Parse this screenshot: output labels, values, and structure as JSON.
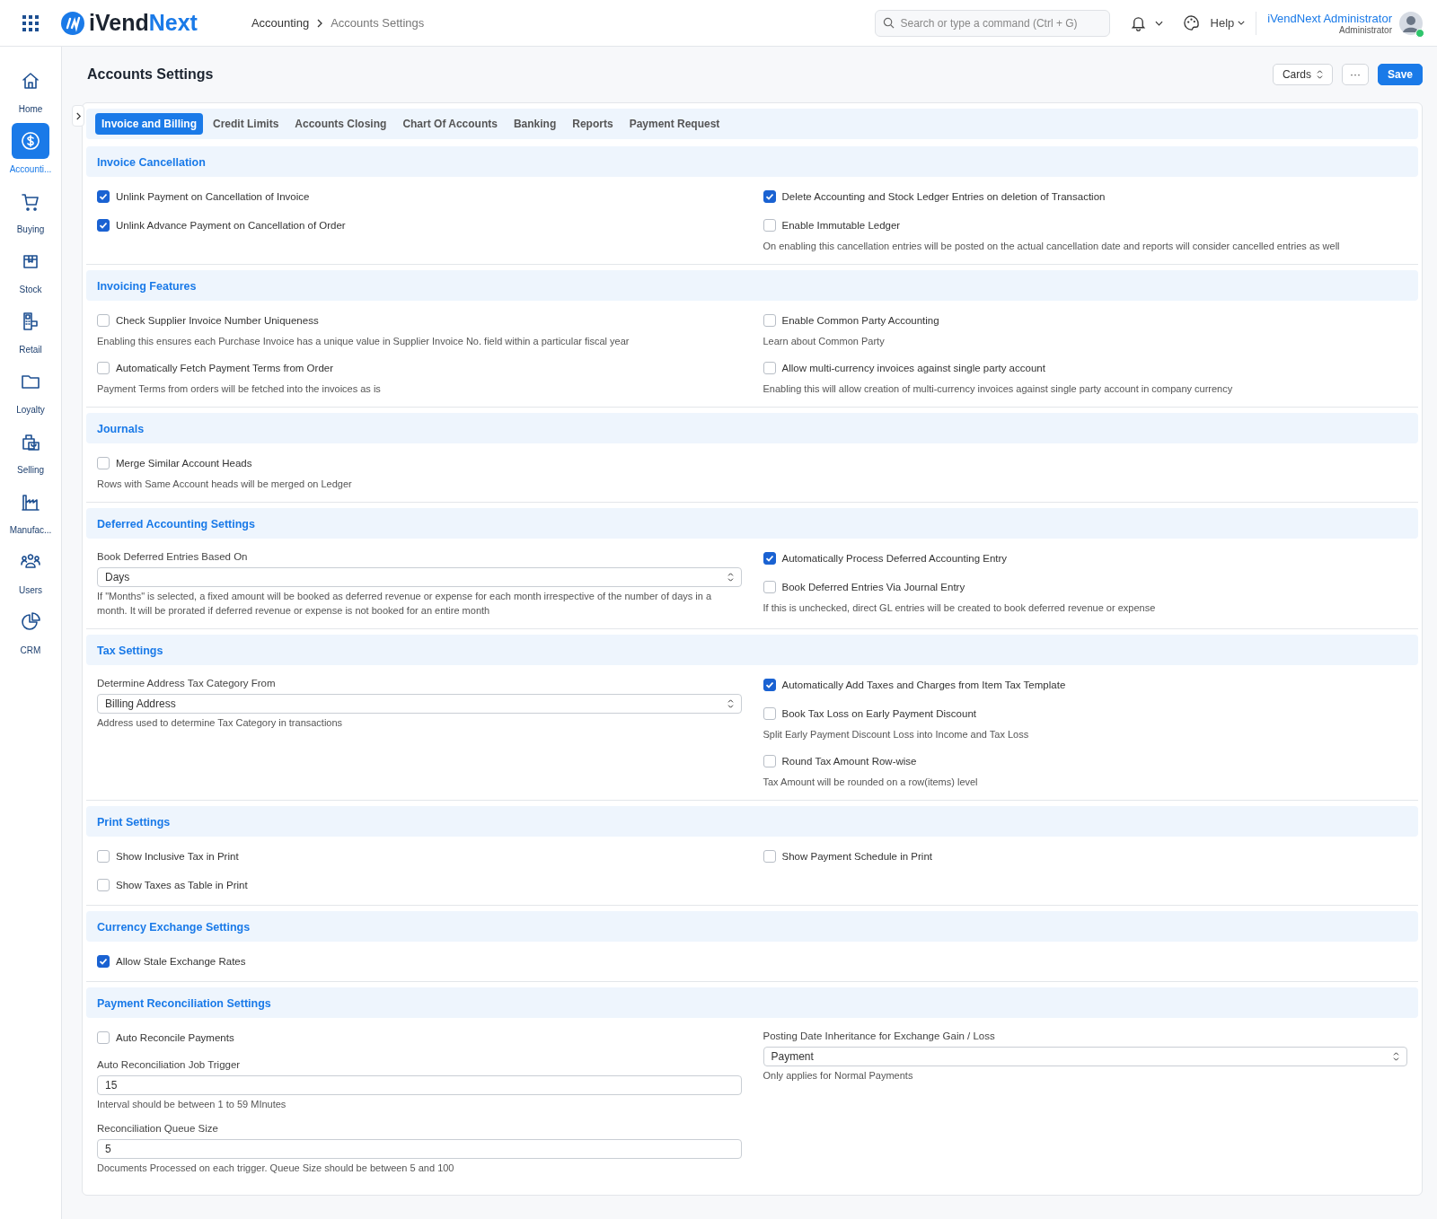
{
  "topbar": {
    "logo_prefix": "iVend",
    "logo_suffix": "Next",
    "breadcrumb": [
      "Accounting",
      "Accounts Settings"
    ],
    "search": {
      "placeholder": "Search or type a command (Ctrl + G)"
    },
    "help": "Help",
    "user": {
      "name": "iVendNext Administrator",
      "role": "Administrator"
    }
  },
  "sidebar": {
    "items": [
      {
        "label": "Home",
        "selected": false
      },
      {
        "label": "Accounti...",
        "selected": true
      },
      {
        "label": "Buying",
        "selected": false
      },
      {
        "label": "Stock",
        "selected": false
      },
      {
        "label": "Retail",
        "selected": false
      },
      {
        "label": "Loyalty",
        "selected": false
      },
      {
        "label": "Selling",
        "selected": false
      },
      {
        "label": "Manufac...",
        "selected": false
      },
      {
        "label": "Users",
        "selected": false
      },
      {
        "label": "CRM",
        "selected": false
      }
    ]
  },
  "page": {
    "title": "Accounts Settings",
    "view_button": "Cards",
    "more_button": "···",
    "save_button": "Save"
  },
  "tabs": [
    {
      "label": "Invoice and Billing",
      "selected": true
    },
    {
      "label": "Credit Limits",
      "selected": false
    },
    {
      "label": "Accounts Closing",
      "selected": false
    },
    {
      "label": "Chart Of Accounts",
      "selected": false
    },
    {
      "label": "Banking",
      "selected": false
    },
    {
      "label": "Reports",
      "selected": false
    },
    {
      "label": "Payment Request",
      "selected": false
    }
  ],
  "sections": [
    {
      "title": "Invoice Cancellation",
      "left": [
        {
          "kind": "check",
          "label": "Unlink Payment on Cancellation of Invoice",
          "checked": true
        },
        {
          "kind": "check",
          "label": "Unlink Advance Payment on Cancellation of Order",
          "checked": true
        }
      ],
      "right": [
        {
          "kind": "check",
          "label": "Delete Accounting and Stock Ledger Entries on deletion of Transaction",
          "checked": true
        },
        {
          "kind": "check",
          "label": "Enable Immutable Ledger",
          "checked": false,
          "help": "On enabling this cancellation entries will be posted on the actual cancellation date and reports will consider cancelled entries as well"
        }
      ]
    },
    {
      "title": "Invoicing Features",
      "left": [
        {
          "kind": "check",
          "label": "Check Supplier Invoice Number Uniqueness",
          "checked": false,
          "help": "Enabling this ensures each Purchase Invoice has a unique value in Supplier Invoice No. field within a particular fiscal year"
        },
        {
          "kind": "check",
          "label": "Automatically Fetch Payment Terms from Order",
          "checked": false,
          "help": "Payment Terms from orders will be fetched into the invoices as is"
        }
      ],
      "right": [
        {
          "kind": "check",
          "label": "Enable Common Party Accounting",
          "checked": false,
          "help": "Learn about Common Party"
        },
        {
          "kind": "check",
          "label": "Allow multi-currency invoices against single party account",
          "checked": false,
          "help": "Enabling this will allow creation of multi-currency invoices against single party account in company currency"
        }
      ]
    },
    {
      "title": "Journals",
      "left": [
        {
          "kind": "check",
          "label": "Merge Similar Account Heads",
          "checked": false,
          "help": "Rows with Same Account heads will be merged on Ledger"
        }
      ]
    },
    {
      "title": "Deferred Accounting Settings",
      "left": [
        {
          "kind": "select",
          "label": "Book Deferred Entries Based On",
          "value": "Days",
          "help": "If \"Months\" is selected, a fixed amount will be booked as deferred revenue or expense for each month irrespective of the number of days in a month. It will be prorated if deferred revenue or expense is not booked for an entire month"
        }
      ],
      "right": [
        {
          "kind": "check",
          "label": "Automatically Process Deferred Accounting Entry",
          "checked": true
        },
        {
          "kind": "check",
          "label": "Book Deferred Entries Via Journal Entry",
          "checked": false,
          "help": "If this is unchecked, direct GL entries will be created to book deferred revenue or expense"
        }
      ]
    },
    {
      "title": "Tax Settings",
      "left": [
        {
          "kind": "select",
          "label": "Determine Address Tax Category From",
          "value": "Billing Address",
          "help": "Address used to determine Tax Category in transactions"
        }
      ],
      "right": [
        {
          "kind": "check",
          "label": "Automatically Add Taxes and Charges from Item Tax Template",
          "checked": true
        },
        {
          "kind": "check",
          "label": "Book Tax Loss on Early Payment Discount",
          "checked": false,
          "help": "Split Early Payment Discount Loss into Income and Tax Loss"
        },
        {
          "kind": "check",
          "label": "Round Tax Amount Row-wise",
          "checked": false,
          "help": "Tax Amount will be rounded on a row(items) level"
        }
      ]
    },
    {
      "title": "Print Settings",
      "left": [
        {
          "kind": "check",
          "label": "Show Inclusive Tax in Print",
          "checked": false
        },
        {
          "kind": "check",
          "label": "Show Taxes as Table in Print",
          "checked": false
        }
      ],
      "right": [
        {
          "kind": "check",
          "label": "Show Payment Schedule in Print",
          "checked": false
        }
      ]
    },
    {
      "title": "Currency Exchange Settings",
      "left": [
        {
          "kind": "check",
          "label": "Allow Stale Exchange Rates",
          "checked": true
        }
      ]
    },
    {
      "title": "Payment Reconciliation Settings",
      "left": [
        {
          "kind": "check",
          "label": "Auto Reconcile Payments",
          "checked": false
        },
        {
          "kind": "input",
          "label": "Auto Reconciliation Job Trigger",
          "value": "15",
          "help": "Interval should be between 1 to 59 MInutes"
        },
        {
          "kind": "input",
          "label": "Reconciliation Queue Size",
          "value": "5",
          "help": "Documents Processed on each trigger. Queue Size should be between 5 and 100"
        }
      ],
      "right": [
        {
          "kind": "select",
          "label": "Posting Date Inheritance for Exchange Gain / Loss",
          "value": "Payment",
          "help": "Only applies for Normal Payments"
        }
      ]
    }
  ]
}
